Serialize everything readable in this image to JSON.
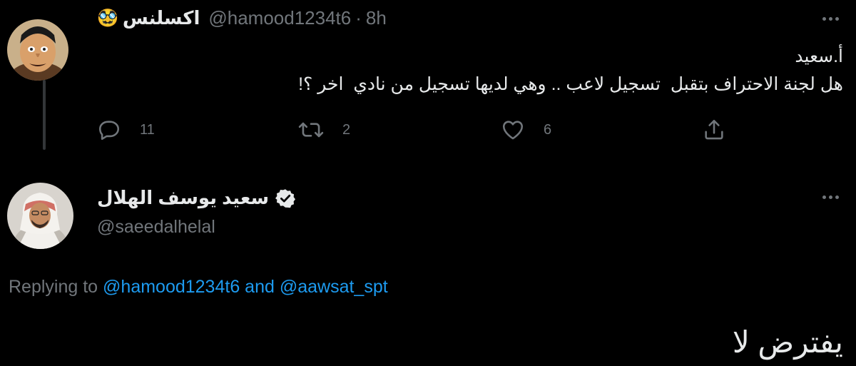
{
  "original_tweet": {
    "display_name": "اكسلنس",
    "name_emoji": "🥸",
    "handle": "@hamood1234t6",
    "separator": "·",
    "time": "8h",
    "text_line1": "أ.سعيد",
    "text_line2": "هل لجنة الاحتراف بتقبل  تسجيل لاعب .. وهي لديها تسجيل من نادي  اخر ؟!",
    "reply_count": "11",
    "retweet_count": "2",
    "like_count": "6"
  },
  "reply_tweet": {
    "display_name": "سعيد يوسف الهلال",
    "handle": "@saeedalhelal",
    "replying_prefix": "Replying to",
    "mention1": "@hamood1234t6",
    "conjunction": "and",
    "mention2": "@aawsat_spt",
    "text": "يفترض لا"
  },
  "colors": {
    "background": "#000000",
    "text": "#e7e9ea",
    "secondary": "#71767b",
    "accent": "#1d9bf0",
    "thread_line": "#333639"
  }
}
